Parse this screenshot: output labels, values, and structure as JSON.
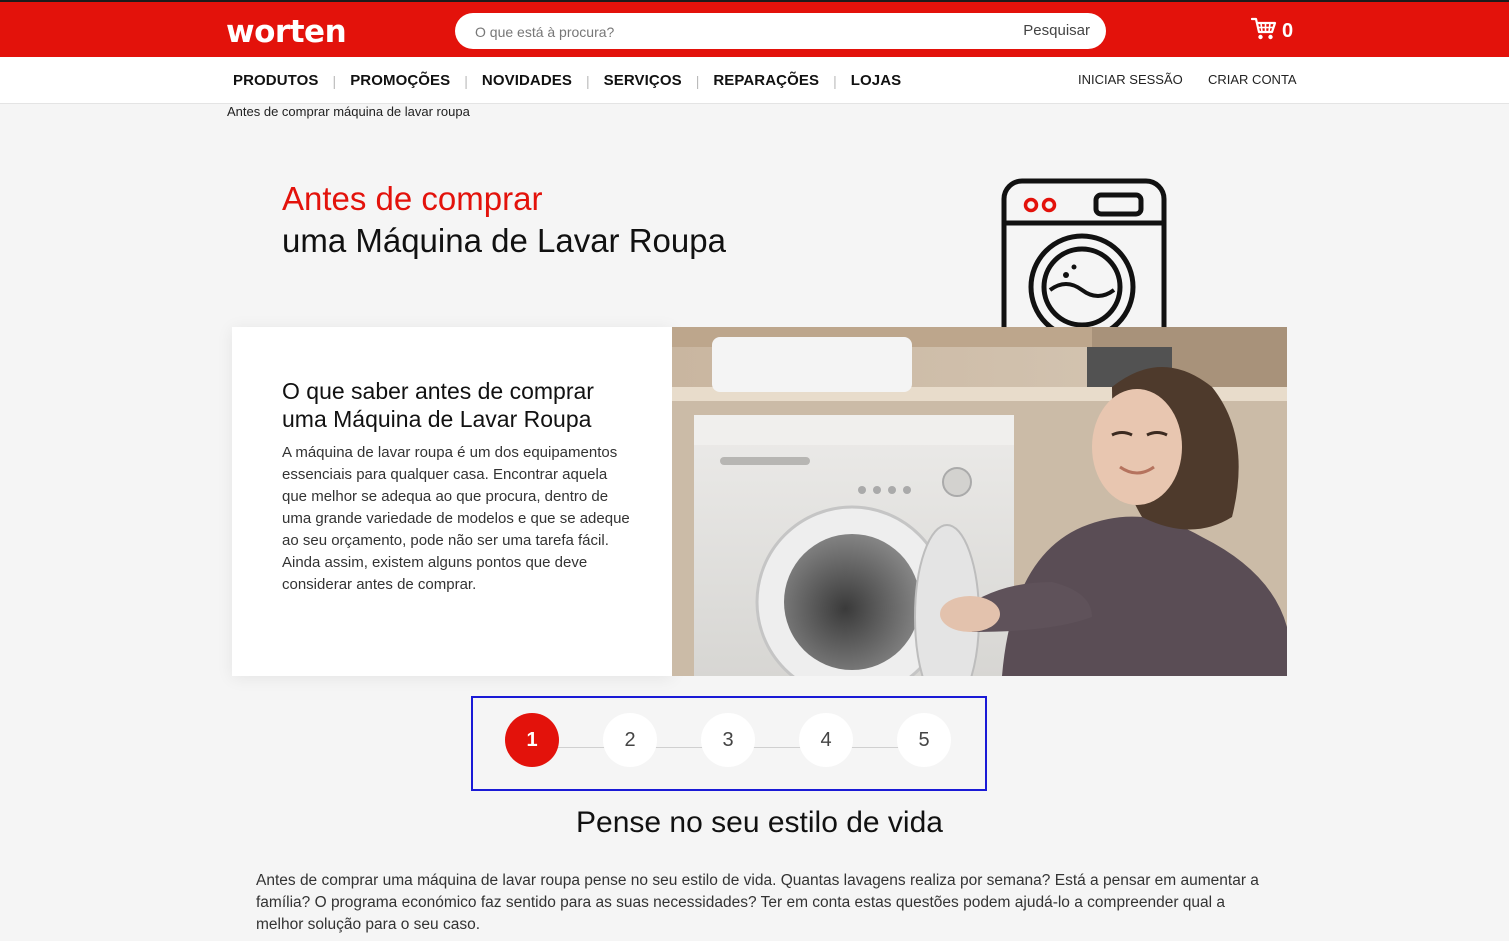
{
  "header": {
    "logo": "worten",
    "search": {
      "placeholder": "O que está à procura?",
      "button": "Pesquisar"
    },
    "cart_count": "0"
  },
  "nav": {
    "items": [
      "PRODUTOS",
      "PROMOÇÕES",
      "NOVIDADES",
      "SERVIÇOS",
      "REPARAÇÕES",
      "LOJAS"
    ],
    "login": "INICIAR SESSÃO",
    "register": "CRIAR CONTA"
  },
  "breadcrumb": "Antes de comprar máquina de lavar roupa",
  "hero": {
    "title_red": "Antes de comprar",
    "title_black": "uma Máquina de Lavar Roupa"
  },
  "intro": {
    "title": "O que saber antes de comprar uma Máquina de Lavar Roupa",
    "text": "A máquina de lavar roupa é um dos equipamentos essenciais para qualquer casa. Encontrar aquela que melhor se adequa ao que procura, dentro de uma grande variedade de modelos e que se adeque ao seu orçamento, pode não ser uma tarefa fácil. Ainda assim, existem alguns pontos que deve considerar antes de comprar."
  },
  "steps": {
    "labels": [
      "1",
      "2",
      "3",
      "4",
      "5"
    ],
    "active": 1
  },
  "section": {
    "title": "Pense no seu estilo de vida",
    "text": "Antes de comprar uma máquina de lavar roupa pense no seu estilo de vida. Quantas lavagens realiza por semana? Está a pensar em aumentar a família? O programa económico faz sentido para as suas necessidades? Ter em conta estas questões podem ajudá-lo a compreender qual a melhor solução para o seu caso."
  },
  "colors": {
    "brand_red": "#e3120b",
    "highlight_border": "#1a1ad6"
  },
  "icons": [
    "cart-icon",
    "washing-machine-icon"
  ]
}
